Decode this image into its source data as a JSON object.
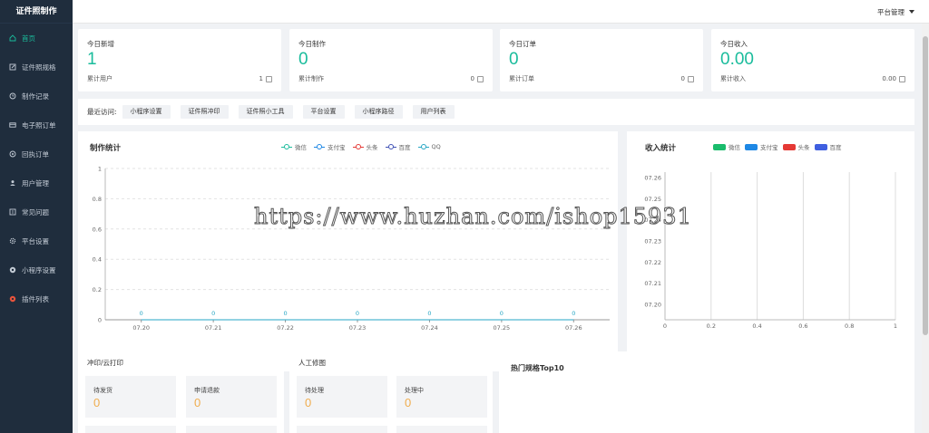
{
  "sidebar": {
    "brand": "证件照制作",
    "items": [
      {
        "label": "首页",
        "icon": "home-icon",
        "active": true
      },
      {
        "label": "证件照规格",
        "icon": "edit-icon"
      },
      {
        "label": "制作记录",
        "icon": "clock-icon"
      },
      {
        "label": "电子照订单",
        "icon": "card-icon"
      },
      {
        "label": "回执订单",
        "icon": "receipt-icon"
      },
      {
        "label": "用户管理",
        "icon": "users-icon"
      },
      {
        "label": "常见问题",
        "icon": "question-icon"
      },
      {
        "label": "平台设置",
        "icon": "gear-icon"
      },
      {
        "label": "小程序设置",
        "icon": "miniapp-icon"
      },
      {
        "label": "插件列表",
        "icon": "plugin-icon"
      }
    ]
  },
  "topbar": {
    "platform_menu": "平台管理"
  },
  "stats": [
    {
      "label": "今日新增",
      "value": "1",
      "foot_label": "累计用户",
      "foot_value": "1",
      "icon": "user-icon"
    },
    {
      "label": "今日制作",
      "value": "0",
      "foot_label": "累计制作",
      "foot_value": "0",
      "icon": "doc-icon"
    },
    {
      "label": "今日订单",
      "value": "0",
      "foot_label": "累计订单",
      "foot_value": "0",
      "icon": "doc-icon"
    },
    {
      "label": "今日收入",
      "value": "0.00",
      "foot_label": "累计收入",
      "foot_value": "0.00",
      "icon": "doc-icon"
    }
  ],
  "recent": {
    "label": "最近访问:",
    "items": [
      "小程序设置",
      "证件照冲印",
      "证件照小工具",
      "平台设置",
      "小程序路径",
      "用户列表"
    ]
  },
  "colors": {
    "accent": "#1abc9c",
    "orange": "#f0ad4e",
    "sidebar_bg": "#1f2d3d"
  },
  "chart_data": [
    {
      "type": "line",
      "title": "制作统计",
      "categories": [
        "07.20",
        "07.21",
        "07.22",
        "07.23",
        "07.24",
        "07.25",
        "07.26"
      ],
      "ylim": [
        0,
        1
      ],
      "yticks": [
        "0",
        "0.2",
        "0.4",
        "0.6",
        "0.8",
        "1"
      ],
      "point_labels": [
        "0",
        "0",
        "0",
        "0",
        "0",
        "0",
        "0"
      ],
      "grid": true,
      "legend": "top",
      "series": [
        {
          "name": "微信",
          "color": "#1abc9c",
          "values": [
            0,
            0,
            0,
            0,
            0,
            0,
            0
          ]
        },
        {
          "name": "支付宝",
          "color": "#1e88e5",
          "values": [
            0,
            0,
            0,
            0,
            0,
            0,
            0
          ]
        },
        {
          "name": "头条",
          "color": "#e53935",
          "values": [
            0,
            0,
            0,
            0,
            0,
            0,
            0
          ]
        },
        {
          "name": "百度",
          "color": "#3f51b5",
          "values": [
            0,
            0,
            0,
            0,
            0,
            0,
            0
          ]
        },
        {
          "name": "QQ",
          "color": "#26a6c4",
          "values": [
            0,
            0,
            0,
            0,
            0,
            0,
            0
          ]
        }
      ]
    },
    {
      "type": "bar",
      "title": "收入统计",
      "categories": [
        "07.26",
        "07.25",
        "07.24",
        "07.23",
        "07.22",
        "07.21",
        "07.20"
      ],
      "xlim": [
        0,
        1
      ],
      "xticks": [
        "0",
        "0.2",
        "0.4",
        "0.6",
        "0.8",
        "1"
      ],
      "grid": true,
      "legend": "top",
      "series": [
        {
          "name": "微信",
          "color": "#1abc6c",
          "values": [
            0,
            0,
            0,
            0,
            0,
            0,
            0
          ]
        },
        {
          "name": "支付宝",
          "color": "#1e88e5",
          "values": [
            0,
            0,
            0,
            0,
            0,
            0,
            0
          ]
        },
        {
          "name": "头条",
          "color": "#e53935",
          "values": [
            0,
            0,
            0,
            0,
            0,
            0,
            0
          ]
        },
        {
          "name": "百度",
          "color": "#3f5fe0",
          "values": [
            0,
            0,
            0,
            0,
            0,
            0,
            0
          ]
        }
      ]
    }
  ],
  "print_card": {
    "title": "冲印/云打印",
    "tiles": [
      {
        "label": "待发货",
        "value": "0"
      },
      {
        "label": "申请退款",
        "value": "0"
      }
    ]
  },
  "retouch_card": {
    "title": "人工修图",
    "tiles": [
      {
        "label": "待处理",
        "value": "0"
      },
      {
        "label": "处理中",
        "value": "0"
      }
    ]
  },
  "top10": {
    "title": "热门规格Top10"
  },
  "watermark": "https://www.huzhan.com/ishop15931"
}
